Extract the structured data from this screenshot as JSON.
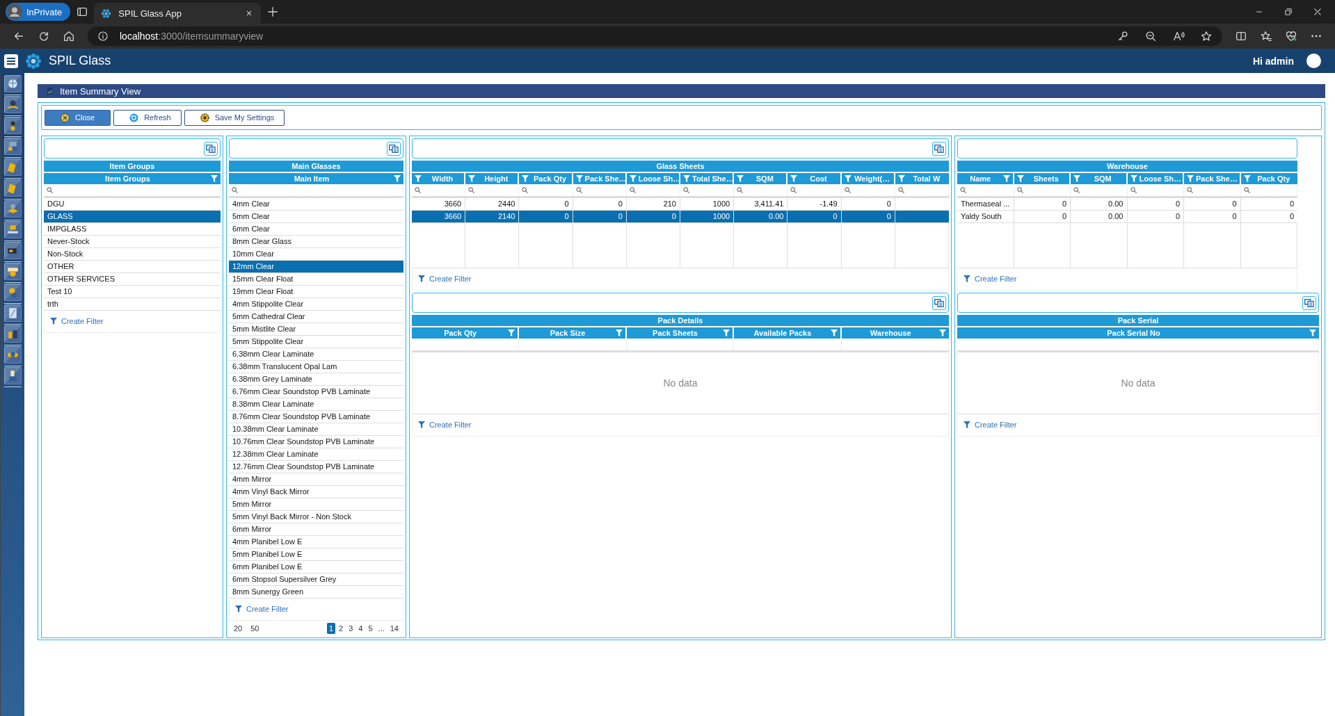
{
  "browser": {
    "profile": "InPrivate",
    "tab_title": "SPIL Glass App",
    "url_host": "localhost",
    "url_path": ":3000/itemsummaryview"
  },
  "app": {
    "title": "SPIL Glass",
    "greeting": "Hi admin"
  },
  "page": {
    "title": "Item Summary View"
  },
  "toolbar": [
    {
      "kind": "close",
      "label": "Close",
      "primary": true
    },
    {
      "kind": "refresh",
      "label": "Refresh",
      "primary": false
    },
    {
      "kind": "save",
      "label": "Save My Settings",
      "primary": false
    }
  ],
  "item_groups": {
    "copy_button": true,
    "title": "Item Groups",
    "search_icons": true,
    "columns": [
      {
        "label": "Item Groups",
        "filter_leading": false
      }
    ],
    "rows": [
      {
        "cells": [
          "DGU"
        ],
        "selected": false
      },
      {
        "cells": [
          "GLASS"
        ],
        "selected": true
      },
      {
        "cells": [
          "IMPGLASS"
        ],
        "selected": false
      },
      {
        "cells": [
          "Never-Stock"
        ],
        "selected": false
      },
      {
        "cells": [
          "Non-Stock"
        ],
        "selected": false
      },
      {
        "cells": [
          "OTHER"
        ],
        "selected": false
      },
      {
        "cells": [
          "OTHER SERVICES"
        ],
        "selected": false
      },
      {
        "cells": [
          "Test 10"
        ],
        "selected": false
      },
      {
        "cells": [
          "trth"
        ],
        "selected": false
      }
    ],
    "create_filter": "Create Filter"
  },
  "main_glasses": {
    "copy_button": true,
    "title": "Main Glasses",
    "search_icons": true,
    "columns": [
      {
        "label": "Main Item",
        "filter_leading": false
      }
    ],
    "rows": [
      {
        "cells": [
          "4mm Clear"
        ],
        "selected": false
      },
      {
        "cells": [
          "5mm Clear"
        ],
        "selected": false
      },
      {
        "cells": [
          "6mm Clear"
        ],
        "selected": false
      },
      {
        "cells": [
          "8mm Clear Glass"
        ],
        "selected": false
      },
      {
        "cells": [
          "10mm Clear"
        ],
        "selected": false
      },
      {
        "cells": [
          "12mm Clear"
        ],
        "selected": true
      },
      {
        "cells": [
          "15mm Clear Float"
        ],
        "selected": false
      },
      {
        "cells": [
          "19mm Clear Float"
        ],
        "selected": false
      },
      {
        "cells": [
          "4mm Stippolite Clear"
        ],
        "selected": false
      },
      {
        "cells": [
          "5mm Cathedral Clear"
        ],
        "selected": false
      },
      {
        "cells": [
          "5mm Mistlite Clear"
        ],
        "selected": false
      },
      {
        "cells": [
          "5mm Stippolite Clear"
        ],
        "selected": false
      },
      {
        "cells": [
          "6.38mm Clear Laminate"
        ],
        "selected": false
      },
      {
        "cells": [
          "6.38mm Translucent Opal Lam"
        ],
        "selected": false
      },
      {
        "cells": [
          "6.38mm Grey Laminate"
        ],
        "selected": false
      },
      {
        "cells": [
          "6.76mm Clear Soundstop PVB Laminate"
        ],
        "selected": false
      },
      {
        "cells": [
          "8.38mm Clear Laminate"
        ],
        "selected": false
      },
      {
        "cells": [
          "8.76mm Clear Soundstop PVB Laminate"
        ],
        "selected": false
      },
      {
        "cells": [
          "10.38mm Clear Laminate"
        ],
        "selected": false
      },
      {
        "cells": [
          "10.76mm Clear Soundstop PVB Laminate"
        ],
        "selected": false
      },
      {
        "cells": [
          "12.38mm Clear Laminate"
        ],
        "selected": false
      },
      {
        "cells": [
          "12.76mm Clear Soundstop PVB Laminate"
        ],
        "selected": false
      },
      {
        "cells": [
          "4mm Mirror"
        ],
        "selected": false
      },
      {
        "cells": [
          "4mm Vinyl Back Mirror"
        ],
        "selected": false
      },
      {
        "cells": [
          "5mm Mirror"
        ],
        "selected": false
      },
      {
        "cells": [
          "5mm Vinyl Back Mirror - Non Stock"
        ],
        "selected": false
      },
      {
        "cells": [
          "6mm Mirror"
        ],
        "selected": false
      },
      {
        "cells": [
          "4mm Planibel Low E"
        ],
        "selected": false
      },
      {
        "cells": [
          "5mm Planibel Low E"
        ],
        "selected": false
      },
      {
        "cells": [
          "6mm Planibel Low E"
        ],
        "selected": false
      },
      {
        "cells": [
          "6mm Stopsol Supersilver Grey"
        ],
        "selected": false
      },
      {
        "cells": [
          "8mm Sunergy Green"
        ],
        "selected": false
      }
    ],
    "create_filter": "Create Filter",
    "pager": {
      "page_sizes": [
        "20",
        "50"
      ],
      "pages": [
        {
          "label": "1",
          "selected": true
        },
        {
          "label": "2",
          "selected": false
        },
        {
          "label": "3",
          "selected": false
        },
        {
          "label": "4",
          "selected": false
        },
        {
          "label": "5",
          "selected": false
        },
        {
          "label": "...",
          "selected": false
        },
        {
          "label": "14",
          "selected": false
        }
      ]
    }
  },
  "glass_sheets": {
    "copy_button": true,
    "title": "Glass Sheets",
    "search_icons": true,
    "columns": [
      {
        "label": "Width",
        "filter_leading": true,
        "kind": "number"
      },
      {
        "label": "Height",
        "filter_leading": true,
        "kind": "number"
      },
      {
        "label": "Pack Qty",
        "filter_leading": true,
        "kind": "number"
      },
      {
        "label": "Pack She…",
        "filter_leading": true,
        "kind": "number"
      },
      {
        "label": "Loose Sh…",
        "filter_leading": true,
        "kind": "number"
      },
      {
        "label": "Total She…",
        "filter_leading": true,
        "kind": "number"
      },
      {
        "label": "SQM",
        "filter_leading": true,
        "kind": "number"
      },
      {
        "label": "Cost",
        "filter_leading": true,
        "kind": "number"
      },
      {
        "label": "Weight(…",
        "filter_leading": true,
        "kind": "number"
      },
      {
        "label": "Total W",
        "filter_leading": true
      }
    ],
    "rows": [
      {
        "cells": [
          "3660",
          "2440",
          "0",
          "0",
          "210",
          "1000",
          "3,411.41",
          "-1.49",
          "0"
        ],
        "selected": false
      },
      {
        "cells": [
          "3660",
          "2140",
          "0",
          "0",
          "0",
          "1000",
          "0.00",
          "0",
          "0"
        ],
        "selected": true
      }
    ],
    "create_filter": "Create Filter"
  },
  "pack_details": {
    "copy_button": true,
    "title": "Pack Details",
    "search_icons": false,
    "columns": [
      {
        "label": "Pack Qty",
        "filter_leading": false
      },
      {
        "label": "Pack Size",
        "filter_leading": false
      },
      {
        "label": "Pack Sheets",
        "filter_leading": false
      },
      {
        "label": "Available Packs",
        "filter_leading": false
      },
      {
        "label": "Warehouse",
        "filter_leading": false
      }
    ],
    "empty_text": "No data",
    "create_filter": "Create Filter"
  },
  "warehouse": {
    "copy_button": false,
    "title": "Warehouse",
    "search_icons": true,
    "columns": [
      {
        "label": "Name",
        "filter_leading": false,
        "kind": "text"
      },
      {
        "label": "Sheets",
        "filter_leading": true,
        "kind": "number"
      },
      {
        "label": "SQM",
        "filter_leading": true,
        "kind": "number"
      },
      {
        "label": "Loose Sh…",
        "filter_leading": true,
        "kind": "number"
      },
      {
        "label": "Pack She…",
        "filter_leading": true,
        "kind": "number"
      },
      {
        "label": "Pack Qty",
        "filter_leading": true,
        "kind": "number"
      }
    ],
    "rows": [
      {
        "cells": [
          "Thermaseal ...",
          "0",
          "0.00",
          "0",
          "0",
          "0"
        ],
        "selected": false
      },
      {
        "cells": [
          "Yaldy South",
          "0",
          "0.00",
          "0",
          "0",
          "0"
        ],
        "selected": false
      }
    ],
    "create_filter": "Create Filter"
  },
  "pack_serial": {
    "copy_button": true,
    "title": "Pack Serial",
    "search_icons": false,
    "columns": [
      {
        "label": "Pack Serial No",
        "filter_leading": false
      }
    ],
    "empty_text": "No data",
    "create_filter": "Create Filter"
  }
}
